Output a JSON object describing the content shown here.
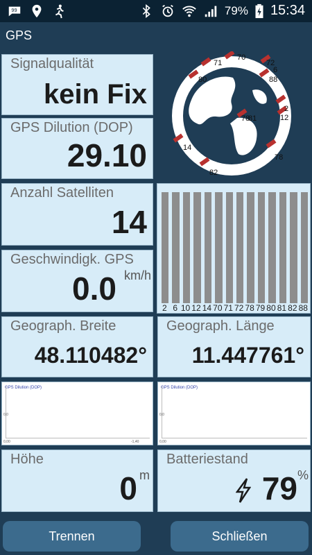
{
  "status_bar": {
    "battery": "79%",
    "time": "15:34",
    "icons_left": [
      "chat-icon",
      "location-pin-icon",
      "running-person-icon"
    ],
    "icons_right": [
      "bluetooth-icon",
      "alarm-icon",
      "wifi-icon",
      "signal-icon",
      "battery-charging-icon"
    ]
  },
  "app": {
    "title": "GPS"
  },
  "tiles": {
    "signal_quality": {
      "label": "Signalqualität",
      "value": "kein Fix"
    },
    "dop": {
      "label": "GPS Dilution (DOP)",
      "value": "29.10"
    },
    "satellites": {
      "label": "Anzahl Satelliten",
      "value": "14"
    },
    "speed": {
      "label": "Geschwindigk. GPS",
      "value": "0.0",
      "unit": "km/h"
    },
    "latitude": {
      "label": "Geograph. Breite",
      "value": "48.110482°"
    },
    "longitude": {
      "label": "Geograph. Länge",
      "value": "11.447761°"
    },
    "altitude": {
      "label": "Höhe",
      "value": "0",
      "unit": "m"
    },
    "battery": {
      "label": "Batteriestand",
      "value": "79",
      "unit": "%",
      "icon": "lightning-icon"
    }
  },
  "globe": {
    "satellites": [
      "71",
      "70",
      "72",
      "6",
      "80",
      "88",
      "78",
      "81",
      "2",
      "12",
      "14",
      "78",
      "82"
    ]
  },
  "sat_signal_chart": {
    "labels": [
      "2",
      "6",
      "10",
      "12",
      "14",
      "70",
      "71",
      "72",
      "78",
      "79",
      "80",
      "81",
      "82",
      "88"
    ]
  },
  "charts": {
    "left": {
      "title": "GPS Dilution (DOP)",
      "tick_left": "0,0",
      "tick_bottom_left": "0,00",
      "tick_bottom_right": "-1,40"
    },
    "right": {
      "title": "GPS Dilution (DOP)",
      "tick_left": "0,0",
      "tick_bottom_left": "0,00"
    }
  },
  "buttons": {
    "disconnect": "Trennen",
    "close": "Schließen"
  },
  "colors": {
    "tile_bg": "#d7ecf8",
    "app_bg": "#1f3d55",
    "button_bg": "#3c6b8d",
    "satellite_red": "#b8312f"
  }
}
